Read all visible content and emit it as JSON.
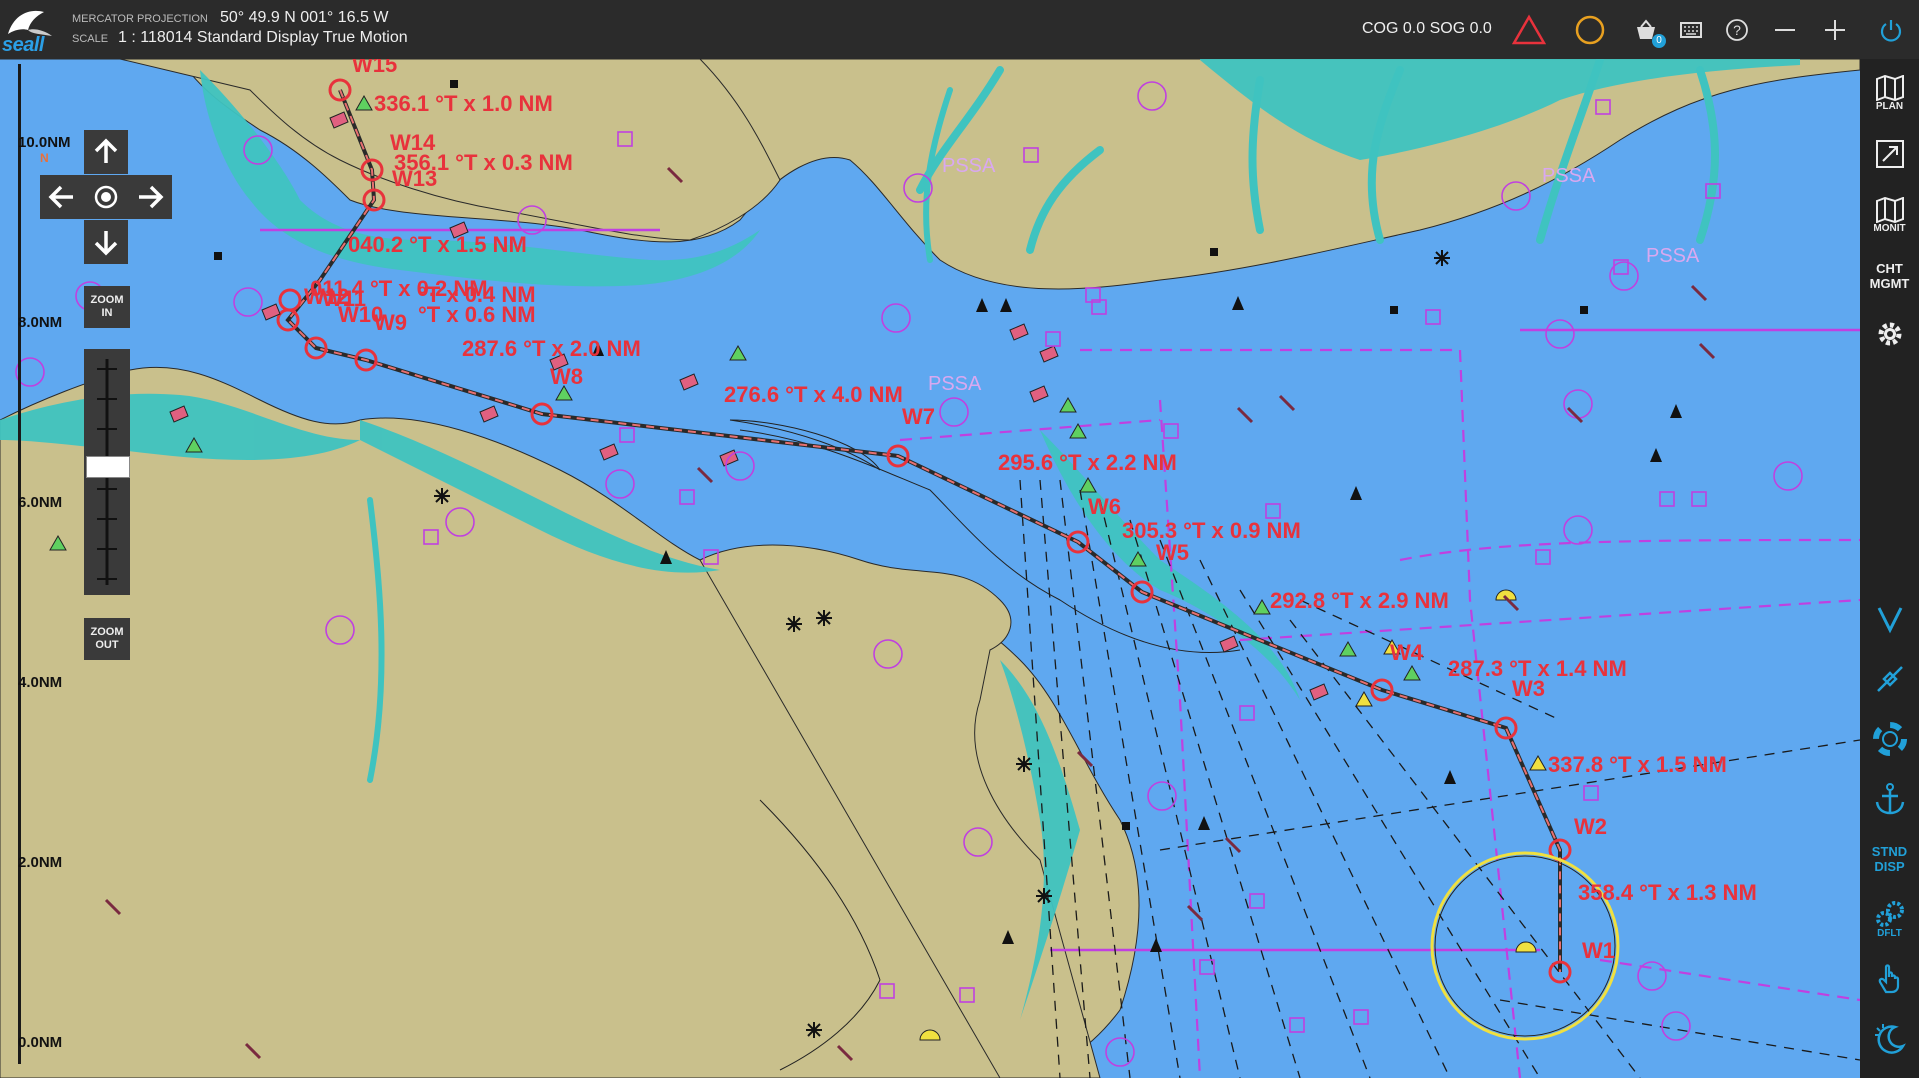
{
  "header": {
    "logo_text": "seall",
    "projection_label": "MERCATOR PROJECTION",
    "position": "50° 49.9 N 001° 16.5 W",
    "scale_label": "SCALE",
    "scale_value": "1 : 118014 Standard Display True Motion",
    "cog_sog": "COG 0.0  SOG 0.0",
    "badge_count": "0",
    "icons": [
      "alarm-triangle-icon",
      "warning-circle-icon",
      "basket-icon",
      "keyboard-icon",
      "help-icon",
      "zoom-minus-icon",
      "zoom-plus-icon",
      "power-icon"
    ],
    "colors": {
      "alarm": "#e8323c",
      "warning": "#e8a020",
      "accent": "#21a0d8"
    }
  },
  "left_controls": {
    "zoom_in": "ZOOM IN",
    "zoom_out": "ZOOM OUT",
    "scale_marks": [
      "10.0NM",
      "8.0NM",
      "6.0NM",
      "4.0NM",
      "2.0NM",
      "0.0NM"
    ],
    "north_marker": "N"
  },
  "right_toolbar": {
    "plan": "PLAN",
    "monit": "MONIT",
    "cht_mgmt": "CHT MGMT",
    "stnd_disp": "STND DISP",
    "dflt": "DFLT",
    "icons": [
      "plan-map-icon",
      "chart-window-icon",
      "monitor-map-icon",
      "settings-gear-icon",
      "vector-v-icon",
      "waypoint-pin-icon",
      "lifebuoy-icon",
      "anchor-icon",
      "dflt-gears-icon",
      "hand-pan-icon",
      "night-mode-icon"
    ]
  },
  "chart": {
    "colors": {
      "deep_water": "#5fa8f0",
      "shallow_water": "#3fc3c0",
      "land": "#c9c08c",
      "route": "#e8323c",
      "boundary": "#c040e0"
    },
    "pssa_labels": [
      "PSSA",
      "PSSA",
      "PSSA",
      "PSSA"
    ],
    "legs": [
      "336.1 °T x 1.0 NM",
      "356.1 °T x 0.3 NM",
      "040.2 °T x 1.5 NM",
      "011.4 °T x 0.2 NM",
      "°T x 0.4 NM",
      "°T x 0.6 NM",
      "287.6 °T x 2.0 NM",
      "276.6 °T x 4.0 NM",
      "295.6 °T x 2.2 NM",
      "305.3 °T x 0.9 NM",
      "292.8 °T x 2.9 NM",
      "287.3 °T x 1.4 NM",
      "337.8 °T x 1.5 NM",
      "358.4 °T x 1.3 NM"
    ],
    "waypoints": [
      "W15",
      "W14",
      "W13",
      "W12",
      "W11",
      "W10",
      "W9",
      "W8",
      "W7",
      "W6",
      "W5",
      "W4",
      "W3",
      "W2",
      "W1"
    ]
  }
}
